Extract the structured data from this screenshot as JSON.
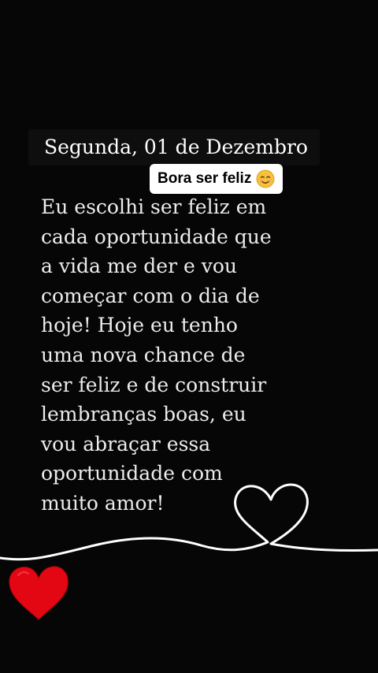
{
  "header": {
    "date": "Segunda, 01 de Dezembro"
  },
  "sticker": {
    "label": "Bora ser feliz",
    "emoji_icon": "smiling-face-icon"
  },
  "message": {
    "lines": [
      "Eu escolhi ser feliz em",
      "cada oportunidade que",
      "a vida me der e vou",
      "começar com o dia de",
      "hoje! Hoje eu tenho",
      "uma nova chance de",
      "ser feliz e de construir",
      "lembranças boas, eu",
      "vou abraçar essa",
      "oportunidade com",
      "muito amor!"
    ]
  },
  "decorations": {
    "swirl_heart_icon": "white-swirl-heart-icon",
    "red_heart_icon": "red-heart-icon",
    "colors": {
      "background": "#060606",
      "text": "#ececec",
      "heart_red": "#e30613",
      "line_white": "#ffffff"
    }
  }
}
